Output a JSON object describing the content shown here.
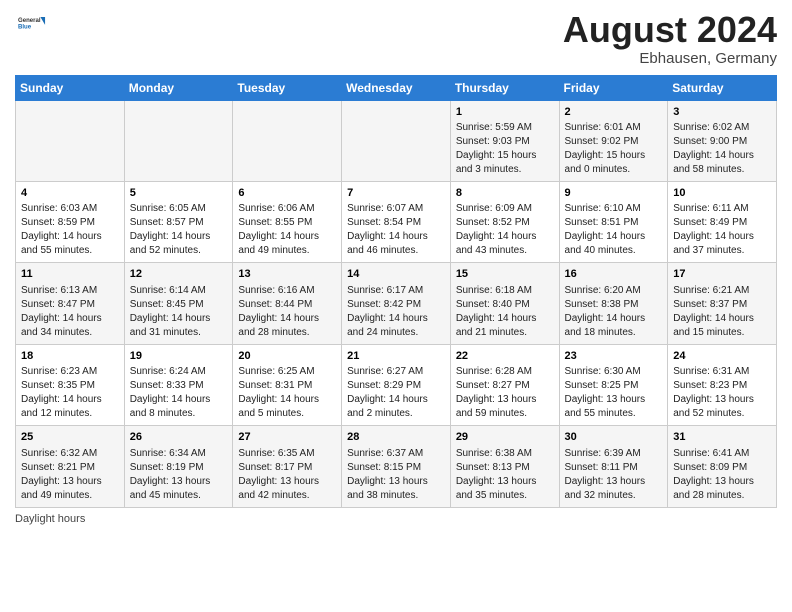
{
  "header": {
    "logo_line1": "General",
    "logo_line2": "Blue",
    "month_year": "August 2024",
    "location": "Ebhausen, Germany"
  },
  "days_of_week": [
    "Sunday",
    "Monday",
    "Tuesday",
    "Wednesday",
    "Thursday",
    "Friday",
    "Saturday"
  ],
  "weeks": [
    [
      {
        "day": "",
        "info": ""
      },
      {
        "day": "",
        "info": ""
      },
      {
        "day": "",
        "info": ""
      },
      {
        "day": "",
        "info": ""
      },
      {
        "day": "1",
        "info": "Sunrise: 5:59 AM\nSunset: 9:03 PM\nDaylight: 15 hours\nand 3 minutes."
      },
      {
        "day": "2",
        "info": "Sunrise: 6:01 AM\nSunset: 9:02 PM\nDaylight: 15 hours\nand 0 minutes."
      },
      {
        "day": "3",
        "info": "Sunrise: 6:02 AM\nSunset: 9:00 PM\nDaylight: 14 hours\nand 58 minutes."
      }
    ],
    [
      {
        "day": "4",
        "info": "Sunrise: 6:03 AM\nSunset: 8:59 PM\nDaylight: 14 hours\nand 55 minutes."
      },
      {
        "day": "5",
        "info": "Sunrise: 6:05 AM\nSunset: 8:57 PM\nDaylight: 14 hours\nand 52 minutes."
      },
      {
        "day": "6",
        "info": "Sunrise: 6:06 AM\nSunset: 8:55 PM\nDaylight: 14 hours\nand 49 minutes."
      },
      {
        "day": "7",
        "info": "Sunrise: 6:07 AM\nSunset: 8:54 PM\nDaylight: 14 hours\nand 46 minutes."
      },
      {
        "day": "8",
        "info": "Sunrise: 6:09 AM\nSunset: 8:52 PM\nDaylight: 14 hours\nand 43 minutes."
      },
      {
        "day": "9",
        "info": "Sunrise: 6:10 AM\nSunset: 8:51 PM\nDaylight: 14 hours\nand 40 minutes."
      },
      {
        "day": "10",
        "info": "Sunrise: 6:11 AM\nSunset: 8:49 PM\nDaylight: 14 hours\nand 37 minutes."
      }
    ],
    [
      {
        "day": "11",
        "info": "Sunrise: 6:13 AM\nSunset: 8:47 PM\nDaylight: 14 hours\nand 34 minutes."
      },
      {
        "day": "12",
        "info": "Sunrise: 6:14 AM\nSunset: 8:45 PM\nDaylight: 14 hours\nand 31 minutes."
      },
      {
        "day": "13",
        "info": "Sunrise: 6:16 AM\nSunset: 8:44 PM\nDaylight: 14 hours\nand 28 minutes."
      },
      {
        "day": "14",
        "info": "Sunrise: 6:17 AM\nSunset: 8:42 PM\nDaylight: 14 hours\nand 24 minutes."
      },
      {
        "day": "15",
        "info": "Sunrise: 6:18 AM\nSunset: 8:40 PM\nDaylight: 14 hours\nand 21 minutes."
      },
      {
        "day": "16",
        "info": "Sunrise: 6:20 AM\nSunset: 8:38 PM\nDaylight: 14 hours\nand 18 minutes."
      },
      {
        "day": "17",
        "info": "Sunrise: 6:21 AM\nSunset: 8:37 PM\nDaylight: 14 hours\nand 15 minutes."
      }
    ],
    [
      {
        "day": "18",
        "info": "Sunrise: 6:23 AM\nSunset: 8:35 PM\nDaylight: 14 hours\nand 12 minutes."
      },
      {
        "day": "19",
        "info": "Sunrise: 6:24 AM\nSunset: 8:33 PM\nDaylight: 14 hours\nand 8 minutes."
      },
      {
        "day": "20",
        "info": "Sunrise: 6:25 AM\nSunset: 8:31 PM\nDaylight: 14 hours\nand 5 minutes."
      },
      {
        "day": "21",
        "info": "Sunrise: 6:27 AM\nSunset: 8:29 PM\nDaylight: 14 hours\nand 2 minutes."
      },
      {
        "day": "22",
        "info": "Sunrise: 6:28 AM\nSunset: 8:27 PM\nDaylight: 13 hours\nand 59 minutes."
      },
      {
        "day": "23",
        "info": "Sunrise: 6:30 AM\nSunset: 8:25 PM\nDaylight: 13 hours\nand 55 minutes."
      },
      {
        "day": "24",
        "info": "Sunrise: 6:31 AM\nSunset: 8:23 PM\nDaylight: 13 hours\nand 52 minutes."
      }
    ],
    [
      {
        "day": "25",
        "info": "Sunrise: 6:32 AM\nSunset: 8:21 PM\nDaylight: 13 hours\nand 49 minutes."
      },
      {
        "day": "26",
        "info": "Sunrise: 6:34 AM\nSunset: 8:19 PM\nDaylight: 13 hours\nand 45 minutes."
      },
      {
        "day": "27",
        "info": "Sunrise: 6:35 AM\nSunset: 8:17 PM\nDaylight: 13 hours\nand 42 minutes."
      },
      {
        "day": "28",
        "info": "Sunrise: 6:37 AM\nSunset: 8:15 PM\nDaylight: 13 hours\nand 38 minutes."
      },
      {
        "day": "29",
        "info": "Sunrise: 6:38 AM\nSunset: 8:13 PM\nDaylight: 13 hours\nand 35 minutes."
      },
      {
        "day": "30",
        "info": "Sunrise: 6:39 AM\nSunset: 8:11 PM\nDaylight: 13 hours\nand 32 minutes."
      },
      {
        "day": "31",
        "info": "Sunrise: 6:41 AM\nSunset: 8:09 PM\nDaylight: 13 hours\nand 28 minutes."
      }
    ]
  ],
  "footer": {
    "daylight_label": "Daylight hours"
  }
}
